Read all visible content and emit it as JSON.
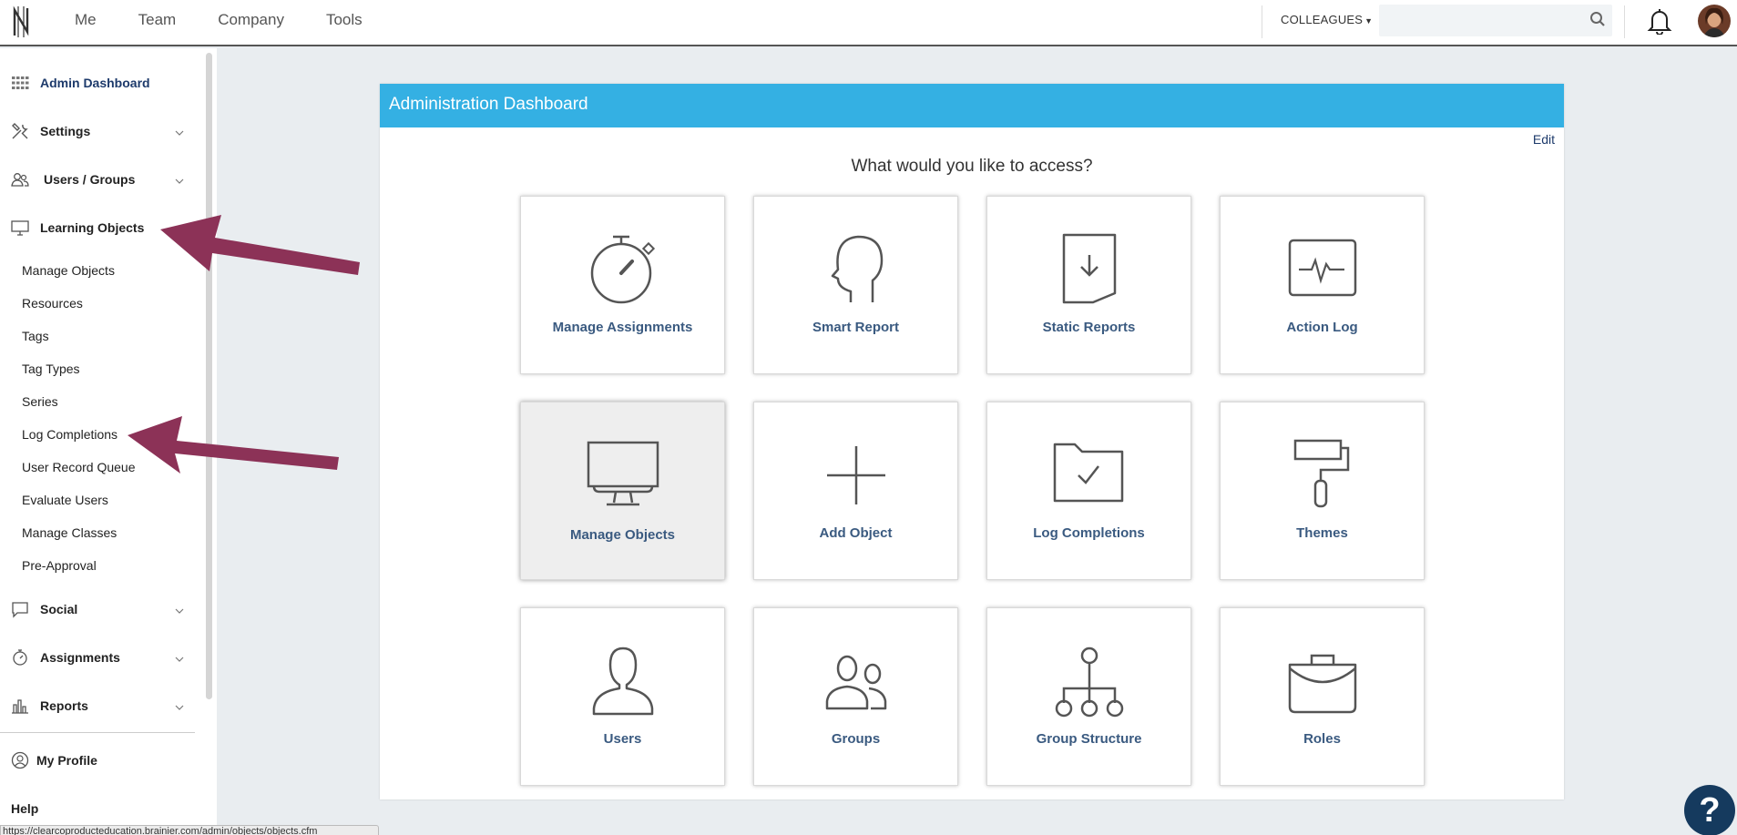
{
  "topbar": {
    "nav": [
      "Me",
      "Team",
      "Company",
      "Tools"
    ],
    "colleagues_label": "COLLEAGUES",
    "search_placeholder": ""
  },
  "sidebar": {
    "sections": [
      {
        "label": "Admin Dashboard",
        "icon": "grid-icon"
      },
      {
        "label": "Settings",
        "icon": "tools-icon"
      },
      {
        "label": "Users / Groups",
        "icon": "users-icon"
      },
      {
        "label": "Learning Objects",
        "icon": "monitor-icon"
      }
    ],
    "sub_items": [
      "Manage Objects",
      "Resources",
      "Tags",
      "Tag Types",
      "Series",
      "Log Completions",
      "User Record Queue",
      "Evaluate Users",
      "Manage Classes",
      "Pre-Approval"
    ],
    "lower_sections": [
      {
        "label": "Social",
        "icon": "chat-icon"
      },
      {
        "label": "Assignments",
        "icon": "stopwatch-icon"
      },
      {
        "label": "Reports",
        "icon": "bar-chart-icon"
      }
    ],
    "my_profile": "My Profile",
    "help": "Help",
    "status_url": "https://clearcoproducteducation.brainier.com/admin/objects/objects.cfm"
  },
  "main": {
    "title": "Administration Dashboard",
    "edit": "Edit",
    "prompt": "What would you like to access?",
    "tiles": [
      {
        "label": "Manage Assignments",
        "icon": "stopwatch-icon"
      },
      {
        "label": "Smart Report",
        "icon": "head-icon"
      },
      {
        "label": "Static Reports",
        "icon": "document-download-icon"
      },
      {
        "label": "Action Log",
        "icon": "pulse-monitor-icon"
      },
      {
        "label": "Manage Objects",
        "icon": "monitor-icon",
        "selected": true
      },
      {
        "label": "Add Object",
        "icon": "plus-icon"
      },
      {
        "label": "Log Completions",
        "icon": "folder-check-icon"
      },
      {
        "label": "Themes",
        "icon": "paint-roller-icon"
      },
      {
        "label": "Users",
        "icon": "user-icon"
      },
      {
        "label": "Groups",
        "icon": "group-icon"
      },
      {
        "label": "Group Structure",
        "icon": "org-chart-icon"
      },
      {
        "label": "Roles",
        "icon": "briefcase-icon"
      }
    ]
  },
  "help_button": "?",
  "colors": {
    "header": "#34b0e3",
    "arrow": "#8c3257",
    "link": "#1d3a6b"
  }
}
